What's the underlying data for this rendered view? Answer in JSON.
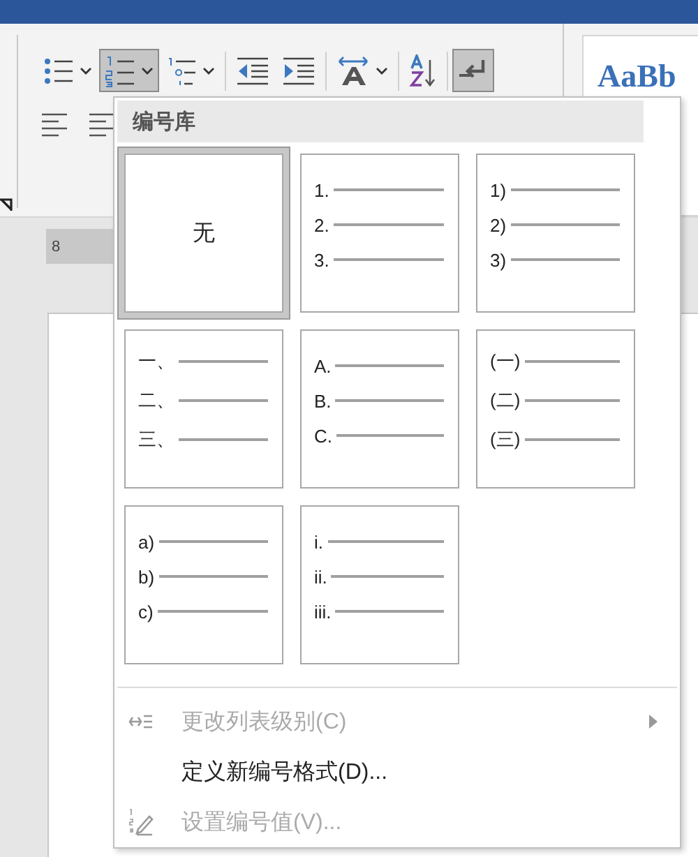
{
  "toolbar": {
    "buttons": [
      {
        "kind": "bullets",
        "selected": false,
        "caret": true
      },
      {
        "kind": "numbering",
        "selected": true,
        "caret": true
      },
      {
        "kind": "multilevel",
        "selected": false,
        "caret": true
      },
      {
        "kind": "outdent",
        "selected": false,
        "caret": false
      },
      {
        "kind": "indent",
        "selected": false,
        "caret": false
      },
      {
        "kind": "direction",
        "selected": false,
        "caret": true
      },
      {
        "kind": "sort",
        "selected": false,
        "caret": false
      },
      {
        "kind": "marks",
        "selected": true,
        "caret": false
      }
    ]
  },
  "styles": {
    "sample": "AaBb"
  },
  "ruler": {
    "label": "8"
  },
  "menu": {
    "title": "编号库",
    "formats": [
      {
        "kind": "none",
        "label": "无",
        "selected": true
      },
      {
        "kind": "list",
        "markers": [
          "1.",
          "2.",
          "3."
        ],
        "selected": false
      },
      {
        "kind": "list",
        "markers": [
          "1)",
          "2)",
          "3)"
        ],
        "selected": false
      },
      {
        "kind": "list",
        "markers": [
          "一、",
          "二、",
          "三、"
        ],
        "selected": false
      },
      {
        "kind": "list",
        "markers": [
          "A.",
          "B.",
          "C."
        ],
        "selected": false
      },
      {
        "kind": "list",
        "markers": [
          "(一)",
          "(二)",
          "(三)"
        ],
        "selected": false
      },
      {
        "kind": "list",
        "markers": [
          "a)",
          "b)",
          "c)"
        ],
        "selected": false
      },
      {
        "kind": "list",
        "markers": [
          "i.",
          "ii.",
          "iii."
        ],
        "selected": false
      }
    ],
    "items": [
      {
        "kind": "level",
        "label": "更改列表级别(C)",
        "disabled": true,
        "submenu": true
      },
      {
        "kind": "define",
        "label": "定义新编号格式(D)...",
        "disabled": false,
        "submenu": false
      },
      {
        "kind": "value",
        "label": "设置编号值(V)...",
        "disabled": true,
        "submenu": false
      }
    ]
  }
}
